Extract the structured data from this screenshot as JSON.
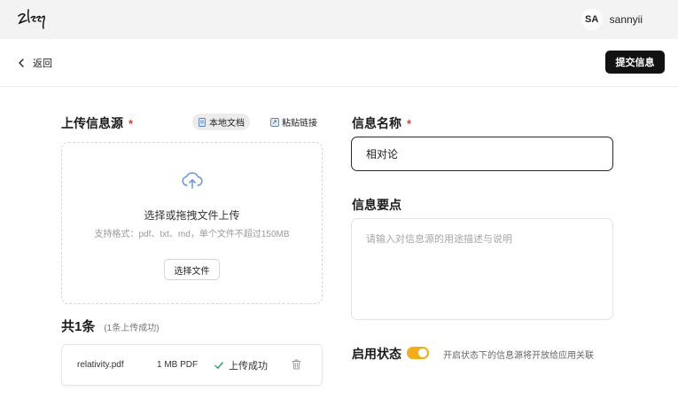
{
  "header": {
    "avatar_initials": "SA",
    "username": "sannyii"
  },
  "toolbar": {
    "back_label": "返回",
    "submit_label": "提交信息"
  },
  "upload": {
    "title": "上传信息源",
    "required_mark": "*",
    "source_tabs": [
      {
        "label": "本地文档",
        "icon": "document-icon",
        "active": true
      },
      {
        "label": "粘贴链接",
        "icon": "link-icon",
        "active": false
      }
    ],
    "dropzone_title": "选择或拖拽文件上传",
    "dropzone_hint": "支持格式：pdf、txt、md，单个文件不超过150MB",
    "choose_button": "选择文件"
  },
  "file_list": {
    "count_title": "共1条",
    "count_subtitle": "(1条上传成功)",
    "files": [
      {
        "name": "relativity.pdf",
        "size": "1 MB PDF",
        "status": "上传成功"
      }
    ]
  },
  "info_name": {
    "title": "信息名称",
    "required_mark": "*",
    "value": "相对论"
  },
  "info_points": {
    "title": "信息要点",
    "placeholder": "请输入对信息源的用途描述与说明"
  },
  "status_toggle": {
    "title": "启用状态",
    "enabled": true,
    "hint": "开启状态下的信息源将开放给应用关联"
  },
  "colors": {
    "accent_toggle": "#f2ad1b",
    "primary_button": "#121212",
    "required": "#d93a3a",
    "success_check": "#2f9e6a",
    "upload_icon": "#6a95d8"
  }
}
